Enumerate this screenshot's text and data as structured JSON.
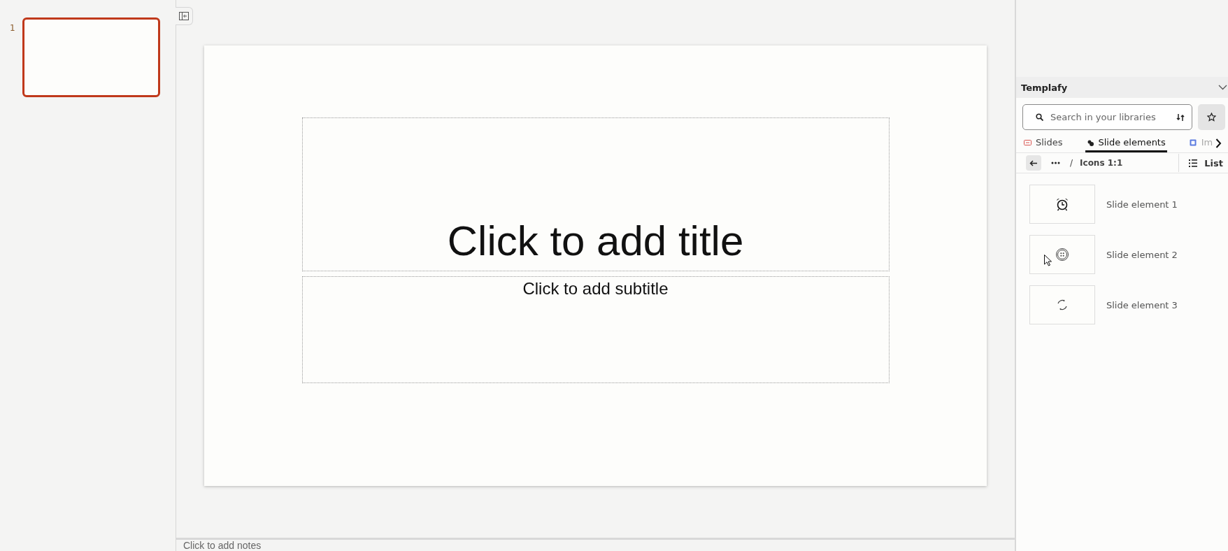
{
  "slide_panel": {
    "slides": [
      {
        "number": "1",
        "selected": true
      }
    ]
  },
  "slide": {
    "title_placeholder": "Click to add title",
    "subtitle_placeholder": "Click to add subtitle"
  },
  "notes": {
    "placeholder": "Click to add notes"
  },
  "templafy": {
    "title": "Templafy",
    "search": {
      "placeholder": "Search in your libraries"
    },
    "tabs": [
      {
        "label": "Slides",
        "kind": "slides",
        "selected": false
      },
      {
        "label": "Slide elements",
        "kind": "elements",
        "selected": true
      },
      {
        "label": "Im",
        "kind": "images",
        "selected": false
      }
    ],
    "breadcrumb": {
      "separator": "/",
      "current": "Icons 1:1"
    },
    "view_button": "List",
    "items": [
      {
        "label": "Slide element 1",
        "kind": "alarm-clock"
      },
      {
        "label": "Slide element 2",
        "kind": "button"
      },
      {
        "label": "Slide element 3",
        "kind": "cycle"
      }
    ]
  }
}
